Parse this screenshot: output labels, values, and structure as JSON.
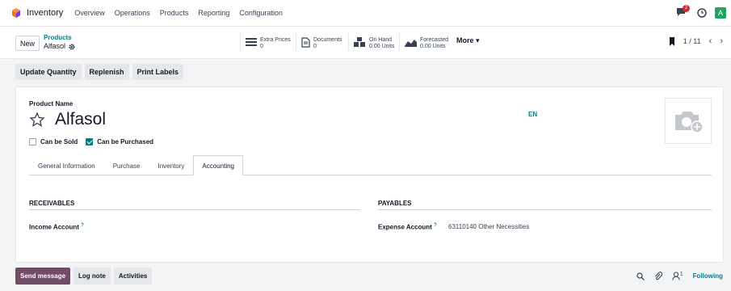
{
  "topnav": {
    "app_name": "Inventory",
    "menu": [
      "Overview",
      "Operations",
      "Products",
      "Reporting",
      "Configuration"
    ],
    "message_count": "2",
    "avatar_letter": "A"
  },
  "control": {
    "new_label": "New",
    "breadcrumb_parent": "Products",
    "breadcrumb_current": "Alfasol",
    "smart_buttons": [
      {
        "label": "Extra Prices",
        "value": "0",
        "icon": "list-icon"
      },
      {
        "label": "Documents",
        "value": "0",
        "icon": "document-icon"
      },
      {
        "label": "On Hand",
        "value": "0.00 Units",
        "icon": "cubes-icon"
      },
      {
        "label": "Forecasted",
        "value": "0.00 Units",
        "icon": "area-chart-icon"
      }
    ],
    "more_label": "More",
    "pager": "1 / 11"
  },
  "actions": [
    "Update Quantity",
    "Replenish",
    "Print Labels"
  ],
  "form": {
    "product_name_label": "Product Name",
    "product_name": "Alfasol",
    "lang": "EN",
    "can_be_sold_label": "Can be Sold",
    "can_be_sold": false,
    "can_be_purchased_label": "Can be Purchased",
    "can_be_purchased": true,
    "tabs": [
      "General Information",
      "Purchase",
      "Inventory",
      "Accounting"
    ],
    "active_tab": "Accounting",
    "receivables_title": "RECEIVABLES",
    "income_account_label": "Income Account",
    "income_account_value": "",
    "payables_title": "PAYABLES",
    "expense_account_label": "Expense Account",
    "expense_account_value": "63110140 Other Necessities",
    "help_mark": "?"
  },
  "chatter": {
    "send_message": "Send message",
    "log_note": "Log note",
    "activities": "Activities",
    "follower_count": "1",
    "following": "Following"
  },
  "colors": {
    "accent": "#017e84",
    "primary": "#714b67",
    "danger": "#dc2626",
    "avatar": "#22a463"
  }
}
